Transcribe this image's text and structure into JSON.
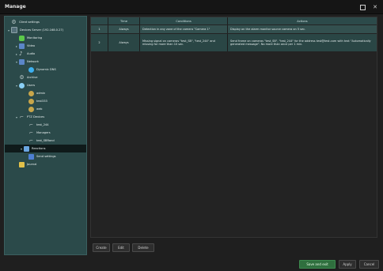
{
  "window": {
    "title": "Manage"
  },
  "tree": {
    "items": [
      {
        "label": "Client settings",
        "icon": "gear-icon"
      },
      {
        "label": "Devices Server (192.168.0.27)",
        "icon": "server-icon"
      },
      {
        "label": "Monitoring",
        "icon": "monitoring-icon"
      },
      {
        "label": "Video",
        "icon": "video-icon"
      },
      {
        "label": "Audio",
        "icon": "audio-icon"
      },
      {
        "label": "Network",
        "icon": "network-icon"
      },
      {
        "label": "Dynamic DNS",
        "icon": "globe-icon"
      },
      {
        "label": "Archive",
        "icon": "archive-icon"
      },
      {
        "label": "Users",
        "icon": "users-icon"
      },
      {
        "label": "admin",
        "icon": "user-icon"
      },
      {
        "label": "test333",
        "icon": "user-icon"
      },
      {
        "label": "web",
        "icon": "user-icon"
      },
      {
        "label": "PTZ Devices",
        "icon": "ptz-icon"
      },
      {
        "label": "test_244",
        "icon": "camera-icon"
      },
      {
        "label": "Managers",
        "icon": "camera-icon"
      },
      {
        "label": "test_SBRand",
        "icon": "camera-icon"
      },
      {
        "label": "Reactions",
        "icon": "reactions-icon"
      },
      {
        "label": "Send settings",
        "icon": "send-settings-icon"
      },
      {
        "label": "Journal",
        "icon": "journal-icon"
      }
    ]
  },
  "table": {
    "headers": [
      "",
      "Time",
      "Conditions",
      "Actions"
    ],
    "rows": [
      {
        "num": "1",
        "time": "Always",
        "conditions": "Detection in any zone of the camera \"Camera 1\"",
        "actions": "Display on the alarm monitor source camera on 5 sec."
      },
      {
        "num": "2",
        "time": "Always",
        "conditions": "Missing signal on cameras \"test_SB\", \"test_244\" and missing for more than 10 sec.",
        "actions": "Send frame on cameras \"test_SB\", \"test_244\" for the address test@test.com with text \"Automatically generated message\". No more than once per 1 min."
      }
    ]
  },
  "buttons": {
    "create": "Create",
    "edit": "Edit",
    "delete": "Delete",
    "save_and_exit": "Save and exit",
    "apply": "Apply",
    "cancel": "Cancel"
  },
  "colors": {
    "accent": "#2f6f3e",
    "panel": "#2b4a4a",
    "header": "#2c4a4a"
  }
}
